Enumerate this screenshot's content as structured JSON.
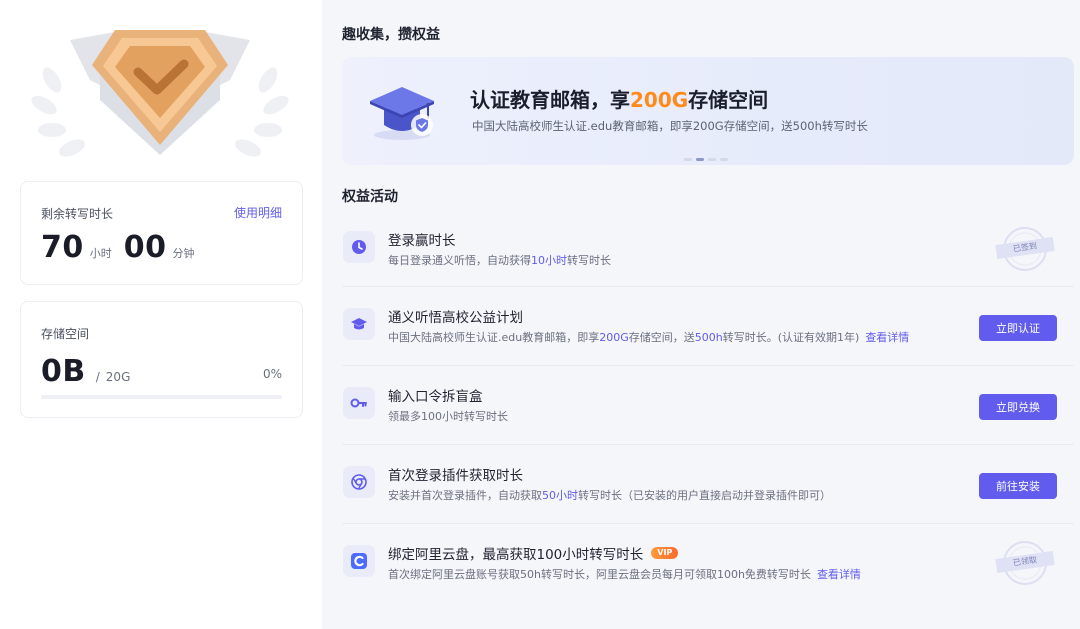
{
  "left": {
    "time_card": {
      "label": "剩余转写时长",
      "link": "使用明细",
      "hours": "70",
      "hours_unit": "小时",
      "minutes": "00",
      "minutes_unit": "分钟"
    },
    "storage_card": {
      "label": "存储空间",
      "used": "0B",
      "separator": "/",
      "total": "20G",
      "percent": "0%",
      "progress_fraction": 0
    }
  },
  "right": {
    "collect_title": "趣收集，攒权益",
    "banner": {
      "headline_pre": "认证教育邮箱，享",
      "headline_highlight": "200G",
      "headline_post": "存储空间",
      "subtitle": "中国大陆高校师生认证.edu教育邮箱，即享200G存储空间，送500h转写时长",
      "dot_count": 4,
      "active_dot": 1
    },
    "activities_title": "权益活动",
    "activities": [
      {
        "icon": "clock-icon",
        "title": "登录赢时长",
        "desc_pre": "每日登录通义听悟，自动获得",
        "desc_hl": "10小时",
        "desc_post": "转写时长",
        "status": "已签到"
      },
      {
        "icon": "graduation-cap-icon",
        "title": "通义听悟高校公益计划",
        "desc_pre": "中国大陆高校师生认证.edu教育邮箱，即享",
        "desc_hl": "200G",
        "desc_mid": "存储空间，送",
        "desc_hl2": "500h",
        "desc_post": "转写时长。(认证有效期1年)",
        "link": "查看详情",
        "button": "立即认证"
      },
      {
        "icon": "key-icon",
        "title": "输入口令拆盲盒",
        "desc": "领最多100小时转写时长",
        "button": "立即兑换"
      },
      {
        "icon": "chrome-icon",
        "title": "首次登录插件获取时长",
        "desc_pre": "安装并首次登录插件，自动获取",
        "desc_hl": "50小时",
        "desc_post": "转写时长（已安装的用户直接启动并登录插件即可）",
        "button": "前往安装"
      },
      {
        "icon": "aliyun-drive-icon",
        "title": "绑定阿里云盘，最高获取100小时转写时长",
        "vip": "VIP",
        "desc": "首次绑定阿里云盘账号获取50h转写时长，阿里云盘会员每月可领取100h免费转写时长",
        "link": "查看详情",
        "status": "已领取"
      }
    ]
  },
  "colors": {
    "accent": "#615ced",
    "highlight_orange": "#ff8a1c",
    "right_bg": "#f5f6fa"
  }
}
